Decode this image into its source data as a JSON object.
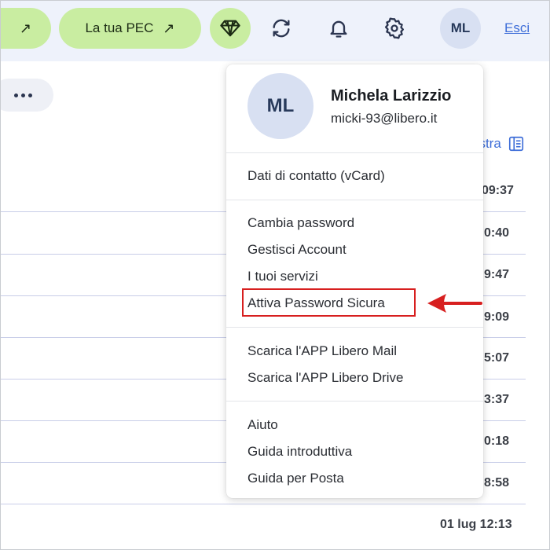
{
  "header": {
    "pill_left_arrow": "↗",
    "pec_label": "La tua PEC",
    "pec_arrow": "↗",
    "premium_icon": "diamond-icon",
    "refresh_icon": "refresh-icon",
    "bell_icon": "bell-icon",
    "settings_icon": "gear-icon",
    "avatar_initials": "ML",
    "logout_label": "Esci"
  },
  "toolbar": {
    "more_icon": "more-dots-icon"
  },
  "mail_list": {
    "show_label": "ostra",
    "times": [
      "09:37",
      "0:40",
      "9:47",
      "9:09",
      "5:07",
      "3:37",
      "0:18",
      "8:58",
      "01 lug 12:13"
    ]
  },
  "account_menu": {
    "avatar_initials": "ML",
    "name": "Michela Larizzio",
    "email": "micki-93@libero.it",
    "items": [
      "Dati di contatto (vCard)",
      "Cambia password",
      "Gestisci Account",
      "I tuoi servizi",
      "Attiva Password Sicura",
      "Scarica l'APP Libero Mail",
      "Scarica l'APP Libero Drive",
      "Aiuto",
      "Guida introduttiva",
      "Guida per Posta"
    ]
  },
  "colors": {
    "accent_green": "#c9eda1",
    "header_bg": "#eef2fb",
    "link_blue": "#3d6dd8",
    "highlight_red": "#d71f1f"
  }
}
